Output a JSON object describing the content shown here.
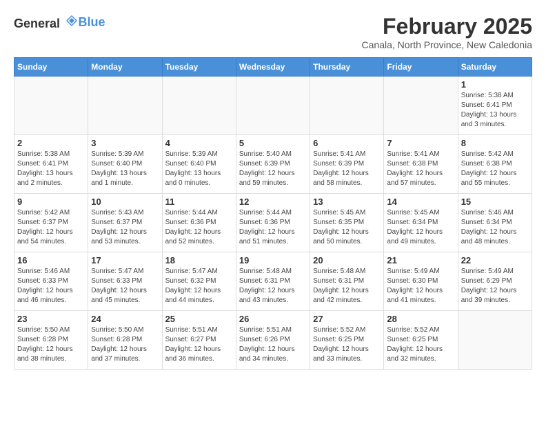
{
  "header": {
    "logo_general": "General",
    "logo_blue": "Blue",
    "month_title": "February 2025",
    "location": "Canala, North Province, New Caledonia"
  },
  "weekdays": [
    "Sunday",
    "Monday",
    "Tuesday",
    "Wednesday",
    "Thursday",
    "Friday",
    "Saturday"
  ],
  "weeks": [
    [
      {
        "day": "",
        "info": ""
      },
      {
        "day": "",
        "info": ""
      },
      {
        "day": "",
        "info": ""
      },
      {
        "day": "",
        "info": ""
      },
      {
        "day": "",
        "info": ""
      },
      {
        "day": "",
        "info": ""
      },
      {
        "day": "1",
        "info": "Sunrise: 5:38 AM\nSunset: 6:41 PM\nDaylight: 13 hours and 3 minutes."
      }
    ],
    [
      {
        "day": "2",
        "info": "Sunrise: 5:38 AM\nSunset: 6:41 PM\nDaylight: 13 hours and 2 minutes."
      },
      {
        "day": "3",
        "info": "Sunrise: 5:39 AM\nSunset: 6:40 PM\nDaylight: 13 hours and 1 minute."
      },
      {
        "day": "4",
        "info": "Sunrise: 5:39 AM\nSunset: 6:40 PM\nDaylight: 13 hours and 0 minutes."
      },
      {
        "day": "5",
        "info": "Sunrise: 5:40 AM\nSunset: 6:39 PM\nDaylight: 12 hours and 59 minutes."
      },
      {
        "day": "6",
        "info": "Sunrise: 5:41 AM\nSunset: 6:39 PM\nDaylight: 12 hours and 58 minutes."
      },
      {
        "day": "7",
        "info": "Sunrise: 5:41 AM\nSunset: 6:38 PM\nDaylight: 12 hours and 57 minutes."
      },
      {
        "day": "8",
        "info": "Sunrise: 5:42 AM\nSunset: 6:38 PM\nDaylight: 12 hours and 55 minutes."
      }
    ],
    [
      {
        "day": "9",
        "info": "Sunrise: 5:42 AM\nSunset: 6:37 PM\nDaylight: 12 hours and 54 minutes."
      },
      {
        "day": "10",
        "info": "Sunrise: 5:43 AM\nSunset: 6:37 PM\nDaylight: 12 hours and 53 minutes."
      },
      {
        "day": "11",
        "info": "Sunrise: 5:44 AM\nSunset: 6:36 PM\nDaylight: 12 hours and 52 minutes."
      },
      {
        "day": "12",
        "info": "Sunrise: 5:44 AM\nSunset: 6:36 PM\nDaylight: 12 hours and 51 minutes."
      },
      {
        "day": "13",
        "info": "Sunrise: 5:45 AM\nSunset: 6:35 PM\nDaylight: 12 hours and 50 minutes."
      },
      {
        "day": "14",
        "info": "Sunrise: 5:45 AM\nSunset: 6:34 PM\nDaylight: 12 hours and 49 minutes."
      },
      {
        "day": "15",
        "info": "Sunrise: 5:46 AM\nSunset: 6:34 PM\nDaylight: 12 hours and 48 minutes."
      }
    ],
    [
      {
        "day": "16",
        "info": "Sunrise: 5:46 AM\nSunset: 6:33 PM\nDaylight: 12 hours and 46 minutes."
      },
      {
        "day": "17",
        "info": "Sunrise: 5:47 AM\nSunset: 6:33 PM\nDaylight: 12 hours and 45 minutes."
      },
      {
        "day": "18",
        "info": "Sunrise: 5:47 AM\nSunset: 6:32 PM\nDaylight: 12 hours and 44 minutes."
      },
      {
        "day": "19",
        "info": "Sunrise: 5:48 AM\nSunset: 6:31 PM\nDaylight: 12 hours and 43 minutes."
      },
      {
        "day": "20",
        "info": "Sunrise: 5:48 AM\nSunset: 6:31 PM\nDaylight: 12 hours and 42 minutes."
      },
      {
        "day": "21",
        "info": "Sunrise: 5:49 AM\nSunset: 6:30 PM\nDaylight: 12 hours and 41 minutes."
      },
      {
        "day": "22",
        "info": "Sunrise: 5:49 AM\nSunset: 6:29 PM\nDaylight: 12 hours and 39 minutes."
      }
    ],
    [
      {
        "day": "23",
        "info": "Sunrise: 5:50 AM\nSunset: 6:28 PM\nDaylight: 12 hours and 38 minutes."
      },
      {
        "day": "24",
        "info": "Sunrise: 5:50 AM\nSunset: 6:28 PM\nDaylight: 12 hours and 37 minutes."
      },
      {
        "day": "25",
        "info": "Sunrise: 5:51 AM\nSunset: 6:27 PM\nDaylight: 12 hours and 36 minutes."
      },
      {
        "day": "26",
        "info": "Sunrise: 5:51 AM\nSunset: 6:26 PM\nDaylight: 12 hours and 34 minutes."
      },
      {
        "day": "27",
        "info": "Sunrise: 5:52 AM\nSunset: 6:25 PM\nDaylight: 12 hours and 33 minutes."
      },
      {
        "day": "28",
        "info": "Sunrise: 5:52 AM\nSunset: 6:25 PM\nDaylight: 12 hours and 32 minutes."
      },
      {
        "day": "",
        "info": ""
      }
    ]
  ]
}
